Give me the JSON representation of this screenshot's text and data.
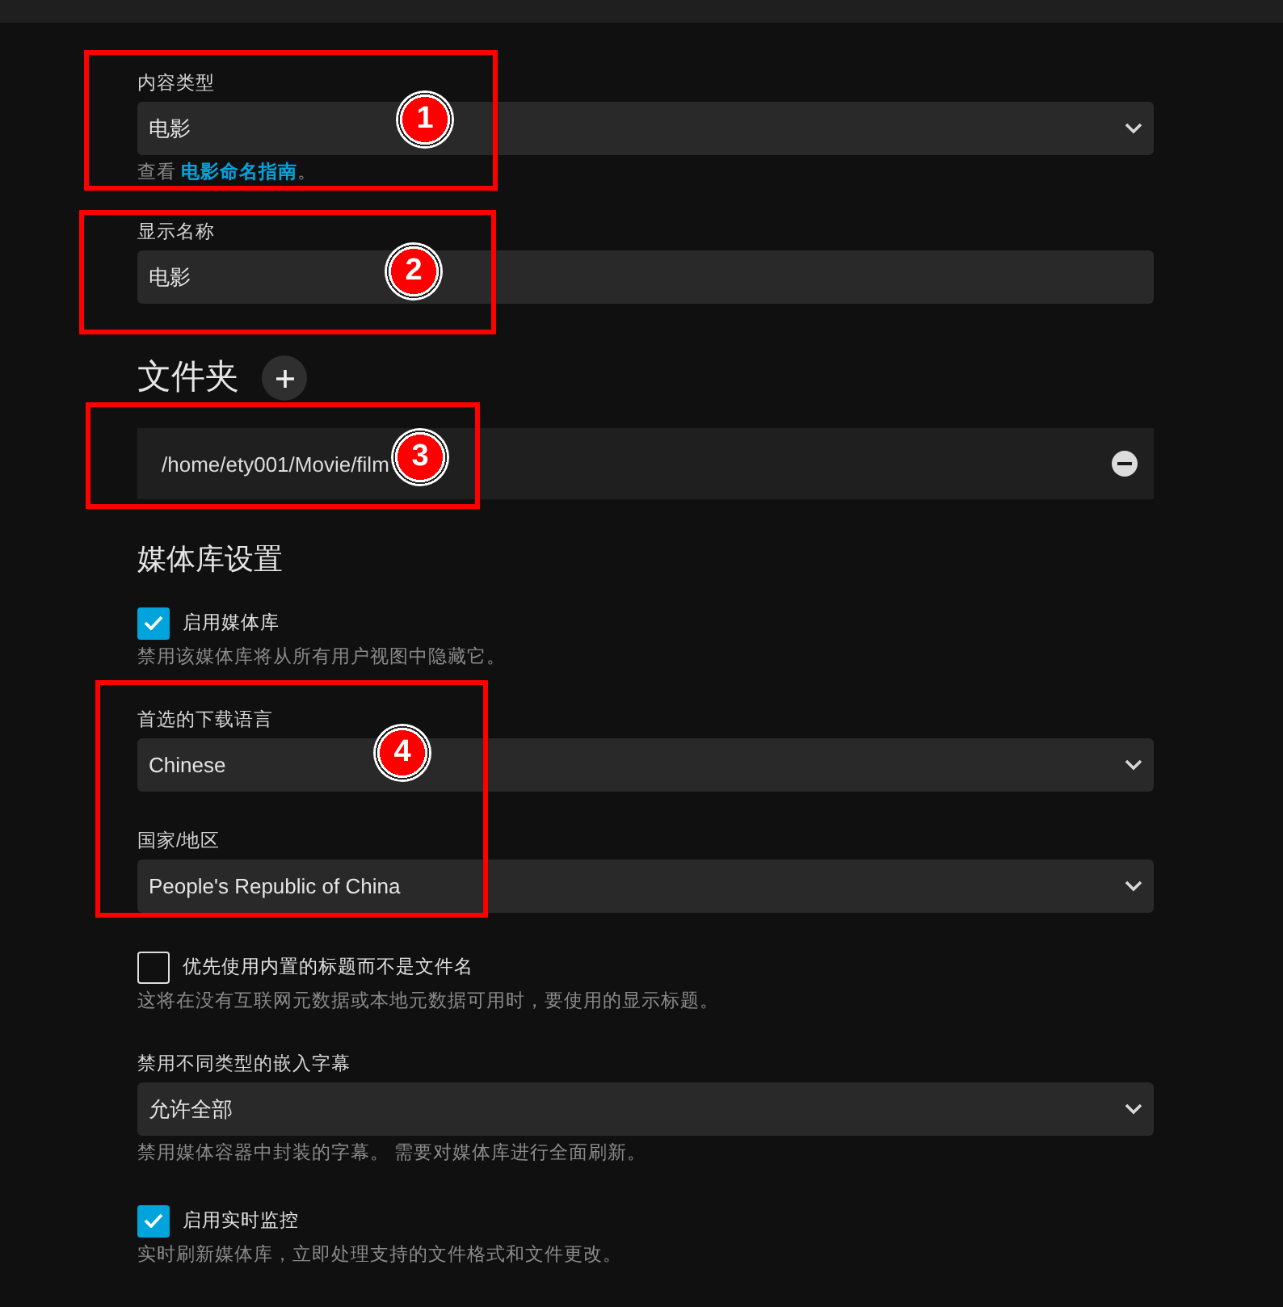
{
  "fields": [
    {
      "kind": "select",
      "label": "内容类型",
      "value": "电影",
      "help": {
        "text": "查看 ",
        "link": "电影命名指南",
        "end": "。"
      }
    },
    {
      "kind": "input",
      "label": "显示名称",
      "value": "电影"
    }
  ],
  "folders": {
    "title": "文件夹",
    "paths": [
      "/home/ety001/Movie/film"
    ]
  },
  "library_settings": {
    "title": "媒体库设置",
    "items": [
      {
        "kind": "checkbox",
        "label": "启用媒体库",
        "checked": true,
        "help": "禁用该媒体库将从所有用户视图中隐藏它。"
      },
      {
        "kind": "select",
        "label": "首选的下载语言",
        "value": "Chinese"
      },
      {
        "kind": "select",
        "label": "国家/地区",
        "value": "People's Republic of China"
      },
      {
        "kind": "checkbox",
        "label": "优先使用内置的标题而不是文件名",
        "checked": false,
        "help": "这将在没有互联网元数据或本地元数据可用时，要使用的显示标题。"
      },
      {
        "kind": "select",
        "label": "禁用不同类型的嵌入字幕",
        "value": "允许全部",
        "help": "禁用媒体容器中封装的字幕。 需要对媒体库进行全面刷新。"
      },
      {
        "kind": "checkbox",
        "label": "启用实时监控",
        "checked": true,
        "help": "实时刷新媒体库，立即处理支持的文件格式和文件更改。"
      }
    ]
  },
  "annotations": [
    {
      "label": "1"
    },
    {
      "label": "2"
    },
    {
      "label": "3"
    },
    {
      "label": "4"
    }
  ]
}
